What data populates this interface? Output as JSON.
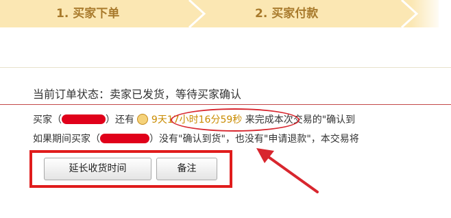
{
  "steps": [
    {
      "label": "1. 买家下单"
    },
    {
      "label": "2. 买家付款"
    }
  ],
  "order": {
    "status_title": "当前订单状态：卖家已发货，等待买家确认",
    "line1_prefix": "买家（",
    "line1_mid": "）还有",
    "countdown": "9天17小时16分59秒",
    "line1_suffix": "来完成本次交易的\"确认到",
    "line2_prefix": "如果期间买家（",
    "line2_suffix": "）没有\"确认到货\"，也没有\"申请退款\"，本交易将"
  },
  "buttons": {
    "extend_label": "延长收货时间",
    "note_label": "备注"
  },
  "colors": {
    "step_bar": "#fbe7b3",
    "step_text": "#a87a2c",
    "countdown": "#c98b00",
    "annotation_red": "#e01c1c"
  },
  "icons": [
    "clock-icon",
    "step-chevron-icon",
    "annotation-arrow-icon"
  ]
}
